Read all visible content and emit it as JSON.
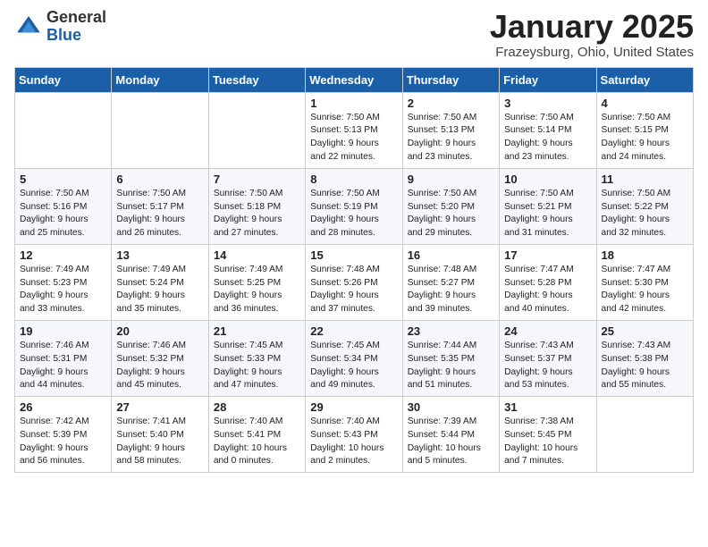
{
  "header": {
    "logo": {
      "general": "General",
      "blue": "Blue"
    },
    "month_title": "January 2025",
    "subtitle": "Frazeysburg, Ohio, United States"
  },
  "days_of_week": [
    "Sunday",
    "Monday",
    "Tuesday",
    "Wednesday",
    "Thursday",
    "Friday",
    "Saturday"
  ],
  "weeks": [
    [
      {
        "day": "",
        "info": ""
      },
      {
        "day": "",
        "info": ""
      },
      {
        "day": "",
        "info": ""
      },
      {
        "day": "1",
        "info": "Sunrise: 7:50 AM\nSunset: 5:13 PM\nDaylight: 9 hours\nand 22 minutes."
      },
      {
        "day": "2",
        "info": "Sunrise: 7:50 AM\nSunset: 5:13 PM\nDaylight: 9 hours\nand 23 minutes."
      },
      {
        "day": "3",
        "info": "Sunrise: 7:50 AM\nSunset: 5:14 PM\nDaylight: 9 hours\nand 23 minutes."
      },
      {
        "day": "4",
        "info": "Sunrise: 7:50 AM\nSunset: 5:15 PM\nDaylight: 9 hours\nand 24 minutes."
      }
    ],
    [
      {
        "day": "5",
        "info": "Sunrise: 7:50 AM\nSunset: 5:16 PM\nDaylight: 9 hours\nand 25 minutes."
      },
      {
        "day": "6",
        "info": "Sunrise: 7:50 AM\nSunset: 5:17 PM\nDaylight: 9 hours\nand 26 minutes."
      },
      {
        "day": "7",
        "info": "Sunrise: 7:50 AM\nSunset: 5:18 PM\nDaylight: 9 hours\nand 27 minutes."
      },
      {
        "day": "8",
        "info": "Sunrise: 7:50 AM\nSunset: 5:19 PM\nDaylight: 9 hours\nand 28 minutes."
      },
      {
        "day": "9",
        "info": "Sunrise: 7:50 AM\nSunset: 5:20 PM\nDaylight: 9 hours\nand 29 minutes."
      },
      {
        "day": "10",
        "info": "Sunrise: 7:50 AM\nSunset: 5:21 PM\nDaylight: 9 hours\nand 31 minutes."
      },
      {
        "day": "11",
        "info": "Sunrise: 7:50 AM\nSunset: 5:22 PM\nDaylight: 9 hours\nand 32 minutes."
      }
    ],
    [
      {
        "day": "12",
        "info": "Sunrise: 7:49 AM\nSunset: 5:23 PM\nDaylight: 9 hours\nand 33 minutes."
      },
      {
        "day": "13",
        "info": "Sunrise: 7:49 AM\nSunset: 5:24 PM\nDaylight: 9 hours\nand 35 minutes."
      },
      {
        "day": "14",
        "info": "Sunrise: 7:49 AM\nSunset: 5:25 PM\nDaylight: 9 hours\nand 36 minutes."
      },
      {
        "day": "15",
        "info": "Sunrise: 7:48 AM\nSunset: 5:26 PM\nDaylight: 9 hours\nand 37 minutes."
      },
      {
        "day": "16",
        "info": "Sunrise: 7:48 AM\nSunset: 5:27 PM\nDaylight: 9 hours\nand 39 minutes."
      },
      {
        "day": "17",
        "info": "Sunrise: 7:47 AM\nSunset: 5:28 PM\nDaylight: 9 hours\nand 40 minutes."
      },
      {
        "day": "18",
        "info": "Sunrise: 7:47 AM\nSunset: 5:30 PM\nDaylight: 9 hours\nand 42 minutes."
      }
    ],
    [
      {
        "day": "19",
        "info": "Sunrise: 7:46 AM\nSunset: 5:31 PM\nDaylight: 9 hours\nand 44 minutes."
      },
      {
        "day": "20",
        "info": "Sunrise: 7:46 AM\nSunset: 5:32 PM\nDaylight: 9 hours\nand 45 minutes."
      },
      {
        "day": "21",
        "info": "Sunrise: 7:45 AM\nSunset: 5:33 PM\nDaylight: 9 hours\nand 47 minutes."
      },
      {
        "day": "22",
        "info": "Sunrise: 7:45 AM\nSunset: 5:34 PM\nDaylight: 9 hours\nand 49 minutes."
      },
      {
        "day": "23",
        "info": "Sunrise: 7:44 AM\nSunset: 5:35 PM\nDaylight: 9 hours\nand 51 minutes."
      },
      {
        "day": "24",
        "info": "Sunrise: 7:43 AM\nSunset: 5:37 PM\nDaylight: 9 hours\nand 53 minutes."
      },
      {
        "day": "25",
        "info": "Sunrise: 7:43 AM\nSunset: 5:38 PM\nDaylight: 9 hours\nand 55 minutes."
      }
    ],
    [
      {
        "day": "26",
        "info": "Sunrise: 7:42 AM\nSunset: 5:39 PM\nDaylight: 9 hours\nand 56 minutes."
      },
      {
        "day": "27",
        "info": "Sunrise: 7:41 AM\nSunset: 5:40 PM\nDaylight: 9 hours\nand 58 minutes."
      },
      {
        "day": "28",
        "info": "Sunrise: 7:40 AM\nSunset: 5:41 PM\nDaylight: 10 hours\nand 0 minutes."
      },
      {
        "day": "29",
        "info": "Sunrise: 7:40 AM\nSunset: 5:43 PM\nDaylight: 10 hours\nand 2 minutes."
      },
      {
        "day": "30",
        "info": "Sunrise: 7:39 AM\nSunset: 5:44 PM\nDaylight: 10 hours\nand 5 minutes."
      },
      {
        "day": "31",
        "info": "Sunrise: 7:38 AM\nSunset: 5:45 PM\nDaylight: 10 hours\nand 7 minutes."
      },
      {
        "day": "",
        "info": ""
      }
    ]
  ]
}
